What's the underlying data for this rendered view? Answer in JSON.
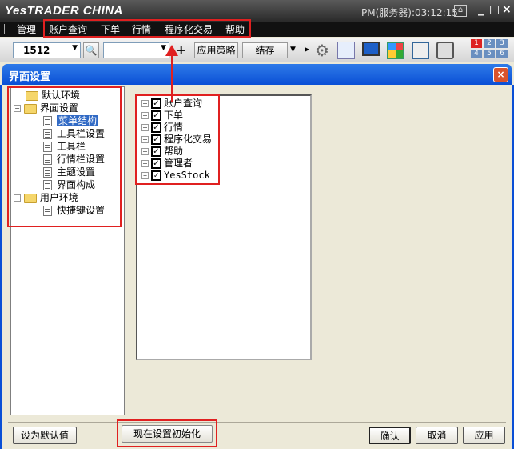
{
  "app": {
    "logo": "YesTRADER CHINA",
    "clock": "PM(服务器):03:12:15",
    "lock_icon": "⌂",
    "minimize": "_",
    "maximize": "□",
    "close": "×"
  },
  "menu": {
    "items": [
      "管理",
      "账户查询",
      "下单",
      "行情",
      "程序化交易",
      "帮助"
    ]
  },
  "toolbar": {
    "code_value": "1512",
    "search_value": "",
    "apply_strategy": "应用策略",
    "save": "结存",
    "screens": [
      "1",
      "2",
      "3",
      "4",
      "5",
      "6"
    ]
  },
  "dialog": {
    "title": "界面设置",
    "close": "×",
    "tree": [
      {
        "label": "默认环境",
        "type": "folder",
        "level": 0
      },
      {
        "label": "界面设置",
        "type": "folder",
        "level": 0,
        "expanded": true
      },
      {
        "label": "菜单结构",
        "type": "doc",
        "level": 1,
        "selected": true
      },
      {
        "label": "工具栏设置",
        "type": "doc",
        "level": 1
      },
      {
        "label": "工具栏",
        "type": "doc",
        "level": 1
      },
      {
        "label": "行情栏设置",
        "type": "doc",
        "level": 1
      },
      {
        "label": "主题设置",
        "type": "doc",
        "level": 1
      },
      {
        "label": "界面构成",
        "type": "doc",
        "level": 1
      },
      {
        "label": "用户环境",
        "type": "folder",
        "level": 0,
        "expanded": true
      },
      {
        "label": "快捷键设置",
        "type": "doc",
        "level": 1
      }
    ],
    "menu_items": [
      {
        "label": "账户查询",
        "checked": true
      },
      {
        "label": "下单",
        "checked": true
      },
      {
        "label": "行情",
        "checked": true
      },
      {
        "label": "程序化交易",
        "checked": true
      },
      {
        "label": "帮助",
        "checked": true
      },
      {
        "label": "管理者",
        "checked": true
      },
      {
        "label": "YesStock",
        "checked": true
      }
    ],
    "buttons": {
      "set_default": "设为默认值",
      "reset_now": "现在设置初始化",
      "ok": "确认",
      "cancel": "取消",
      "apply": "应用"
    }
  }
}
